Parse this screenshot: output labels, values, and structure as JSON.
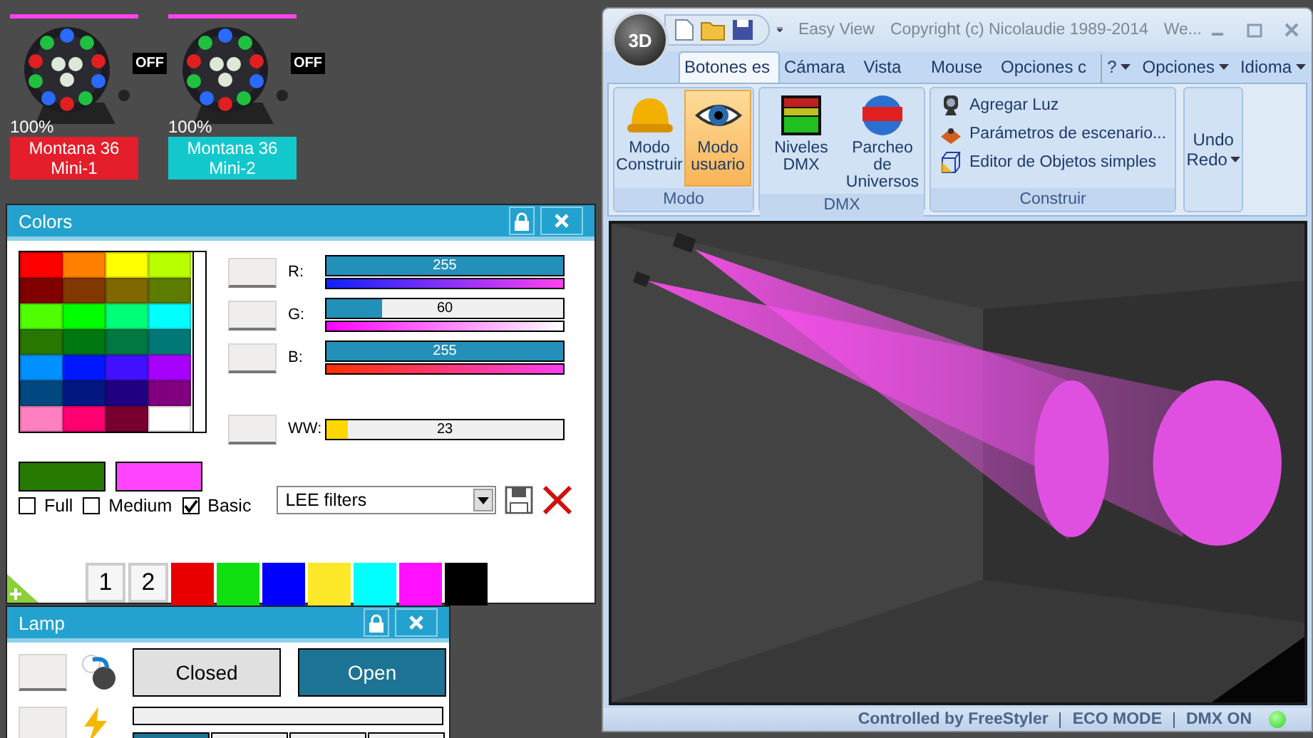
{
  "fixtures": [
    {
      "name": "Montana 36 Mini-1",
      "color": "#e41e2a",
      "status": "OFF",
      "dimmer": "100%"
    },
    {
      "name": "Montana 36 Mini-2",
      "color": "#12c8cc",
      "status": "OFF",
      "dimmer": "100%"
    }
  ],
  "colors_window": {
    "title": "Colors",
    "palette": [
      {
        "color": "#ff0000"
      },
      {
        "color": "#ff8000"
      },
      {
        "color": "#ffff00"
      },
      {
        "color": "#b8ff00"
      },
      {
        "color": "#800000"
      },
      {
        "color": "#803800"
      },
      {
        "color": "#806800"
      },
      {
        "color": "#5c7c00"
      },
      {
        "color": "#50ff00"
      },
      {
        "color": "#00ff00"
      },
      {
        "color": "#00ff78"
      },
      {
        "color": "#00ffff"
      },
      {
        "color": "#287800"
      },
      {
        "color": "#007810"
      },
      {
        "color": "#007840"
      },
      {
        "color": "#007878"
      },
      {
        "color": "#0090ff"
      },
      {
        "color": "#0018ff"
      },
      {
        "color": "#4010ff"
      },
      {
        "color": "#a800ff"
      },
      {
        "color": "#004880"
      },
      {
        "color": "#001880"
      },
      {
        "color": "#200080"
      },
      {
        "color": "#800080"
      },
      {
        "color": "#ff80c0"
      },
      {
        "color": "#ff0070"
      },
      {
        "color": "#780030"
      },
      {
        "color": "#ffffff"
      }
    ],
    "channels": [
      {
        "label": "R:",
        "level": 1,
        "reading": "255",
        "kind": "red"
      },
      {
        "label": "G:",
        "level": 0.235,
        "reading": "60",
        "kind": "green"
      },
      {
        "label": "B:",
        "level": 1,
        "reading": "255",
        "kind": "blue"
      },
      {
        "label": "WW:",
        "level": 0.09,
        "reading": "23",
        "kind": "white"
      }
    ],
    "swatches": [
      {
        "color": "#267a00"
      },
      {
        "color": "#ff44ff"
      }
    ],
    "options": [
      {
        "label": "Full",
        "checked": false
      },
      {
        "label": "Medium",
        "checked": false
      },
      {
        "label": "Basic",
        "checked": true
      }
    ],
    "filter_select": {
      "value": "LEE filters"
    },
    "presets": [
      {
        "kind": "number",
        "label": "1"
      },
      {
        "kind": "number",
        "label": "2"
      },
      {
        "kind": "color",
        "color": "#e80000"
      },
      {
        "kind": "color",
        "color": "#10e010"
      },
      {
        "kind": "color",
        "color": "#0000ff"
      },
      {
        "kind": "color",
        "color": "#fce828"
      },
      {
        "kind": "color",
        "color": "#00ffff"
      },
      {
        "kind": "color",
        "color": "#ff10ff"
      },
      {
        "kind": "color",
        "color": "#000000"
      }
    ]
  },
  "lamp_window": {
    "title": "Lamp",
    "buttons": [
      {
        "label": "Closed",
        "selected": false
      },
      {
        "label": "Open",
        "selected": true
      }
    ],
    "progress": {
      "level": 0
    },
    "segments": [
      {
        "selected": true
      },
      {
        "selected": false
      },
      {
        "selected": false
      },
      {
        "selected": false
      }
    ]
  },
  "main_window": {
    "title": "Easy View",
    "subtitle": "Copyright (c) Nicolaudie 1989-2014",
    "title_tail": "We...",
    "orb": "3D",
    "tabs": [
      {
        "label": "Botones es",
        "selected": true
      },
      {
        "label": "Cámara",
        "selected": false
      },
      {
        "label": "Vista",
        "selected": false
      },
      {
        "label": "Mouse",
        "selected": false
      },
      {
        "label": "Opciones c",
        "selected": false
      }
    ],
    "menus": [
      "?",
      "Opciones",
      "Idioma"
    ],
    "groups": [
      {
        "label": "Modo",
        "kind": "large",
        "items": [
          {
            "label": "Modo Construir",
            "kind": "helmet",
            "selected": false
          },
          {
            "label": "Modo usuario",
            "kind": "eye",
            "selected": true
          }
        ]
      },
      {
        "label": "DMX",
        "kind": "large",
        "items": [
          {
            "label": "Niveles DMX",
            "kind": "meter",
            "selected": false
          },
          {
            "label": "Parcheo de Universos",
            "kind": "globe",
            "selected": false
          }
        ]
      },
      {
        "label": "Construir",
        "kind": "small",
        "items": [
          {
            "label": "Agregar Luz",
            "kind": "spot"
          },
          {
            "label": "Parámetros de escenario...",
            "kind": "stage"
          },
          {
            "label": "Editor de Objetos simples",
            "kind": "cube"
          }
        ]
      }
    ],
    "undo": "Undo",
    "redo": "Redo",
    "status": "Controlled by FreeStyler",
    "eco": "ECO MODE",
    "dmx": "DMX ON"
  }
}
